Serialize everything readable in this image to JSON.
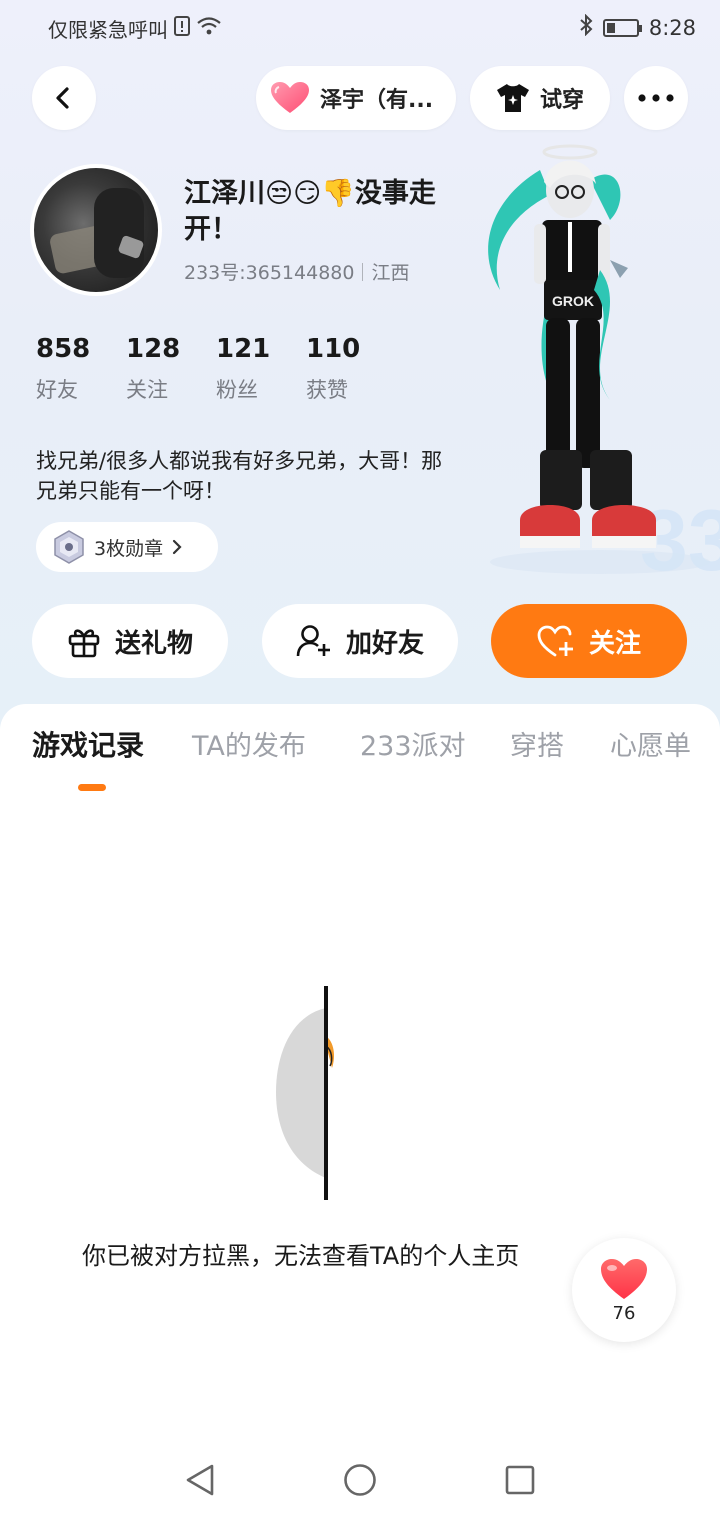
{
  "status_bar": {
    "carrier_text": "仅限紧急呼叫",
    "time": "8:28",
    "battery_level": 0.3
  },
  "header": {
    "name_chip": "泽宇（有...",
    "tryon_label": "试穿"
  },
  "profile": {
    "username": "江泽川😒😏👎没事走开！",
    "uid": "233号:365144880",
    "region": "江西",
    "stats": [
      {
        "value": "858",
        "label": "好友"
      },
      {
        "value": "128",
        "label": "关注"
      },
      {
        "value": "121",
        "label": "粉丝"
      },
      {
        "value": "110",
        "label": "获赞"
      }
    ],
    "bio": "找兄弟/很多人都说我有好多兄弟，大哥！那兄弟只能有一个呀！",
    "medals_label": "3枚勋章"
  },
  "actions": {
    "gift_label": "送礼物",
    "add_friend_label": "加好友",
    "follow_label": "关注"
  },
  "tabs": [
    "游戏记录",
    "TA的发布",
    "233派对",
    "穿搭",
    "心愿单"
  ],
  "active_tab": 0,
  "content": {
    "blocked_message": "你已被对方拉黑，无法查看TA的个人主页"
  },
  "like_float": {
    "count": "76"
  },
  "colors": {
    "accent": "#ff7a12",
    "heart": "#ff4d5e",
    "secondary_text": "#7a7d85"
  }
}
